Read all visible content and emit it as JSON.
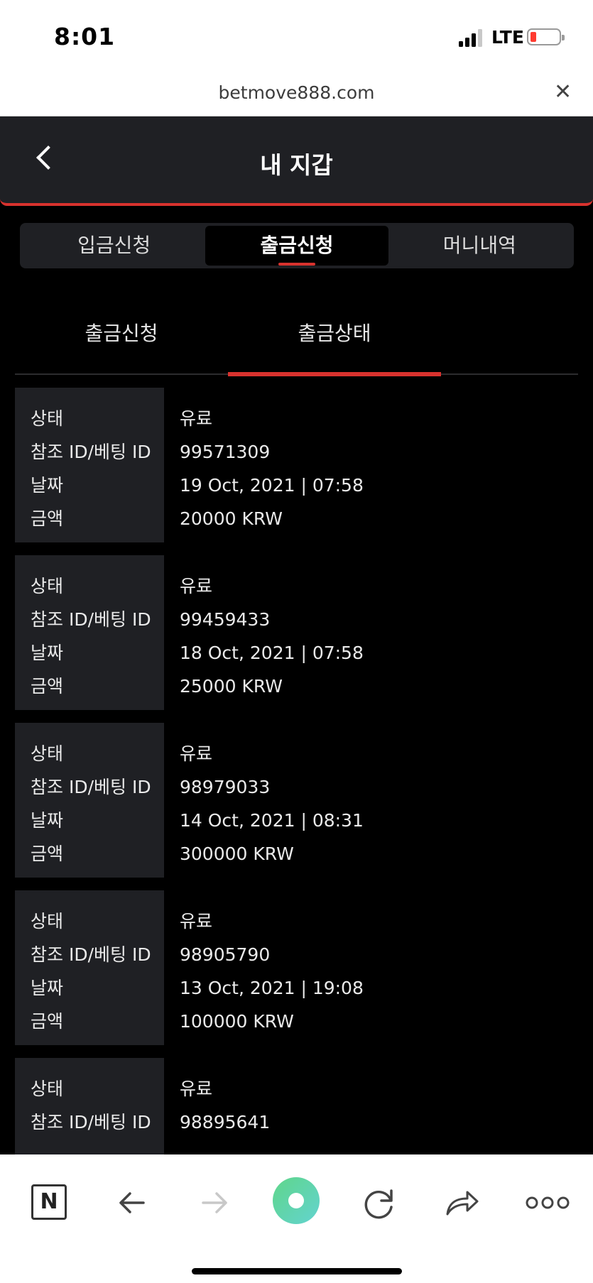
{
  "status_bar": {
    "time": "8:01",
    "network": "LTE"
  },
  "browser": {
    "url": "betmove888.com"
  },
  "header": {
    "title": "내 지갑"
  },
  "main_tabs": [
    {
      "label": "입금신청",
      "active": false
    },
    {
      "label": "출금신청",
      "active": true
    },
    {
      "label": "머니내역",
      "active": false
    }
  ],
  "sub_tabs": [
    {
      "label": "출금신청",
      "active": false
    },
    {
      "label": "출금상태",
      "active": true
    }
  ],
  "labels": {
    "status": "상태",
    "ref_id": "참조 ID/베팅 ID",
    "date": "날짜",
    "amount": "금액"
  },
  "records": [
    {
      "status": "유료",
      "ref_id": "99571309",
      "date": "19 Oct, 2021 | 07:58",
      "amount": "20000 KRW"
    },
    {
      "status": "유료",
      "ref_id": "99459433",
      "date": "18 Oct, 2021 | 07:58",
      "amount": "25000 KRW"
    },
    {
      "status": "유료",
      "ref_id": "98979033",
      "date": "14 Oct, 2021 | 08:31",
      "amount": "300000 KRW"
    },
    {
      "status": "유료",
      "ref_id": "98905790",
      "date": "13 Oct, 2021 | 19:08",
      "amount": "100000 KRW"
    },
    {
      "status": "유료",
      "ref_id": "98895641",
      "date": "",
      "amount": ""
    }
  ],
  "bottom_bar": {
    "n_label": "N",
    "icons": [
      "n-icon",
      "back-arrow-icon",
      "forward-arrow-icon",
      "home-circle-icon",
      "reload-icon",
      "share-icon",
      "more-icon"
    ]
  },
  "colors": {
    "accent": "#d8322e",
    "panel": "#1f2024",
    "background": "#000000",
    "battery_low": "#ff3b30",
    "home_button_gradient": [
      "#5fd68a",
      "#63d3d0"
    ]
  }
}
